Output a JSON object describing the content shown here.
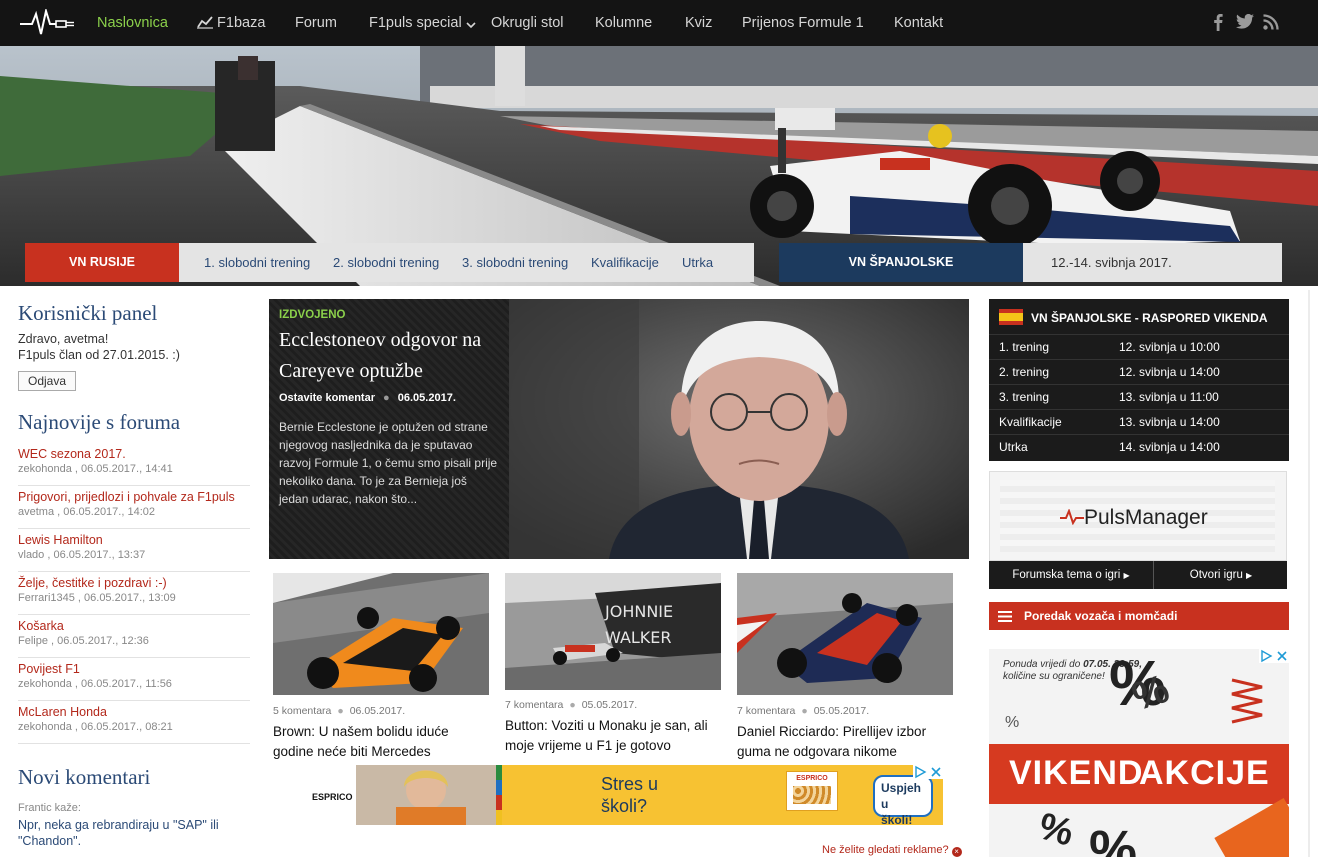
{
  "nav": {
    "items": [
      "Naslovnica",
      "F1baza",
      "Forum",
      "F1puls special",
      "Okrugli stol",
      "Kolumne",
      "Kviz",
      "Prijenos Formule 1",
      "Kontakt"
    ],
    "social": [
      "facebook-icon",
      "twitter-icon",
      "rss-icon"
    ],
    "active_color": "#8bd04b"
  },
  "racebar": {
    "left_title": "VN RUSIJE",
    "sessions": [
      "1. slobodni trening",
      "2. slobodni trening",
      "3. slobodni trening",
      "Kvalifikacije",
      "Utrka"
    ],
    "right_title": "VN ŠPANJOLSKE",
    "right_date": "12.-14. svibnja 2017."
  },
  "user_panel": {
    "title": "Korisnički panel",
    "greeting": "Zdravo, avetma!",
    "member": "F1puls član od 27.01.2015. :)",
    "logout": "Odjava"
  },
  "forum": {
    "title": "Najnovije s foruma",
    "items": [
      {
        "title": "WEC sezona 2017.",
        "meta": "zekohonda , 06.05.2017., 14:41"
      },
      {
        "title": "Prigovori, prijedlozi i pohvale za F1puls",
        "meta": "avetma , 06.05.2017., 14:02"
      },
      {
        "title": "Lewis Hamilton",
        "meta": "vlado , 06.05.2017., 13:37"
      },
      {
        "title": "Želje, čestitke i pozdravi :-)",
        "meta": "Ferrari1345 , 06.05.2017., 13:09"
      },
      {
        "title": "Košarka",
        "meta": "Felipe , 06.05.2017., 12:36"
      },
      {
        "title": "Povijest F1",
        "meta": "zekohonda , 06.05.2017., 11:56"
      },
      {
        "title": "McLaren Honda",
        "meta": "zekohonda , 06.05.2017., 08:21"
      }
    ]
  },
  "comments": {
    "title": "Novi komentari",
    "author": "Frantic kaže:",
    "text": "Npr, neka ga rebrandiraju u \"SAP\" ili \"Chandon\"."
  },
  "featured": {
    "tag": "IZDVOJENO",
    "title": "Ecclestoneov odgovor na Careyeve optužbe",
    "comment_link": "Ostavite komentar",
    "date": "06.05.2017.",
    "excerpt": "Bernie Ecclestone je optužen od strane njegovog nasljednika da je sputavao razvoj Formule 1, o čemu smo pisali prije nekoliko dana. To je za Bernieja još jedan udarac, nakon što..."
  },
  "articles": [
    {
      "comments": "5 komentara",
      "date": "06.05.2017.",
      "title": "Brown: U našem bolidu iduće godine neće biti Mercedes"
    },
    {
      "comments": "7 komentara",
      "date": "05.05.2017.",
      "title": "Button: Voziti u Monaku je san, ali moje vrijeme u F1 je gotovo"
    },
    {
      "comments": "7 komentara",
      "date": "05.05.2017.",
      "title": "Daniel Ricciardo: Pirellijev izbor guma ne odgovara nikome"
    }
  ],
  "article_image_text": {
    "johnnie": "JOHNNIE",
    "walker": "WALKER"
  },
  "schedule": {
    "title": "VN ŠPANJOLSKE - RASPORED VIKENDA",
    "rows": [
      {
        "session": "1. trening",
        "time": "12. svibnja u 10:00"
      },
      {
        "session": "2. trening",
        "time": "12. svibnja u 14:00"
      },
      {
        "session": "3. trening",
        "time": "13. svibnja u 11:00"
      },
      {
        "session": "Kvalifikacije",
        "time": "13. svibnja u 14:00"
      },
      {
        "session": "Utrka",
        "time": "14. svibnja u 14:00"
      }
    ]
  },
  "pulsmanager": {
    "logo": "PulsManager",
    "btn_topic": "Forumska tema o igri",
    "btn_open": "Otvori igru"
  },
  "standings": {
    "label": "Poredak vozača i momčadi"
  },
  "ad_right": {
    "offer_prefix": "Ponuda vrijedi do",
    "offer_date": "07.05. 23:59,",
    "offer_note": "količine su ograničene!",
    "headline_a": "VIKEND",
    "headline_b": "AKCIJE"
  },
  "ad_bottom": {
    "brand": "ESPRICO",
    "slogan_1": "Stres u",
    "slogan_2": "školi?",
    "cta_1": "Uspjeh u",
    "cta_2": "školi!",
    "pack": "ESPRICO"
  },
  "ad_note": "Ne želite gledati reklame?"
}
